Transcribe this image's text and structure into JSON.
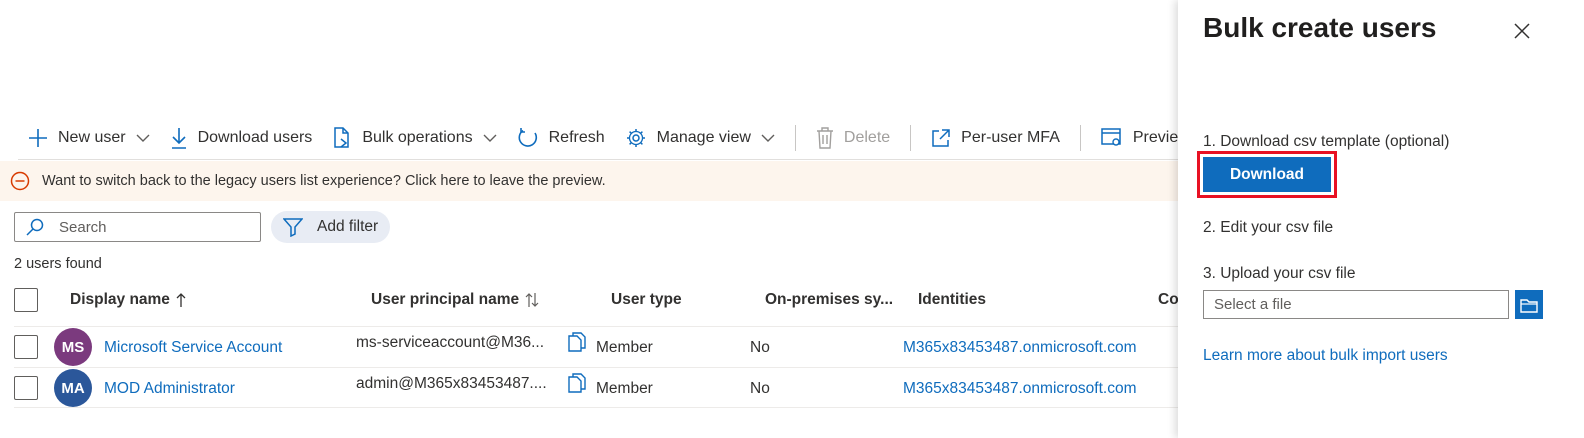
{
  "toolbar": {
    "new_user": "New user",
    "download_users": "Download users",
    "bulk_operations": "Bulk operations",
    "refresh": "Refresh",
    "manage_view": "Manage view",
    "delete": "Delete",
    "per_user_mfa": "Per-user MFA",
    "preview": "Previe"
  },
  "banner": {
    "text": "Want to switch back to the legacy users list experience? Click here to leave the preview."
  },
  "search": {
    "placeholder": "Search"
  },
  "filter": {
    "label": "Add filter"
  },
  "result_count": "2 users found",
  "table": {
    "headers": {
      "display_name": "Display name",
      "upn": "User principal name",
      "user_type": "User type",
      "on_prem": "On-premises sy...",
      "identities": "Identities",
      "company": "Co"
    },
    "rows": [
      {
        "initials": "MS",
        "avatar_color": "#7b3a7e",
        "display_name": "Microsoft Service Account",
        "upn": "ms-serviceaccount@M36...",
        "user_type": "Member",
        "on_prem": "No",
        "identities": "M365x83453487.onmicrosoft.com"
      },
      {
        "initials": "MA",
        "avatar_color": "#2b579a",
        "display_name": "MOD Administrator",
        "upn": "admin@M365x83453487....",
        "user_type": "Member",
        "on_prem": "No",
        "identities": "M365x83453487.onmicrosoft.com"
      }
    ]
  },
  "panel": {
    "title": "Bulk create users",
    "step1": "1. Download csv template (optional)",
    "download_button": "Download",
    "step2": "2. Edit your csv file",
    "step3": "3. Upload your csv file",
    "file_placeholder": "Select a file",
    "learn_more": "Learn more about bulk import users"
  },
  "colors": {
    "accent": "#0f6cbd",
    "highlight_border": "#e81123",
    "banner_bg": "#fdf5ed",
    "banner_icon": "#d83b01"
  },
  "icons": [
    "plus-icon",
    "download-icon",
    "bulk-document-icon",
    "refresh-icon",
    "gear-icon",
    "trash-icon",
    "external-link-icon",
    "preview-settings-icon",
    "warning-circle-icon",
    "search-icon",
    "filter-icon",
    "sort-up-icon",
    "sort-icon",
    "copy-icon",
    "close-icon",
    "folder-icon",
    "chevron-down-icon"
  ]
}
